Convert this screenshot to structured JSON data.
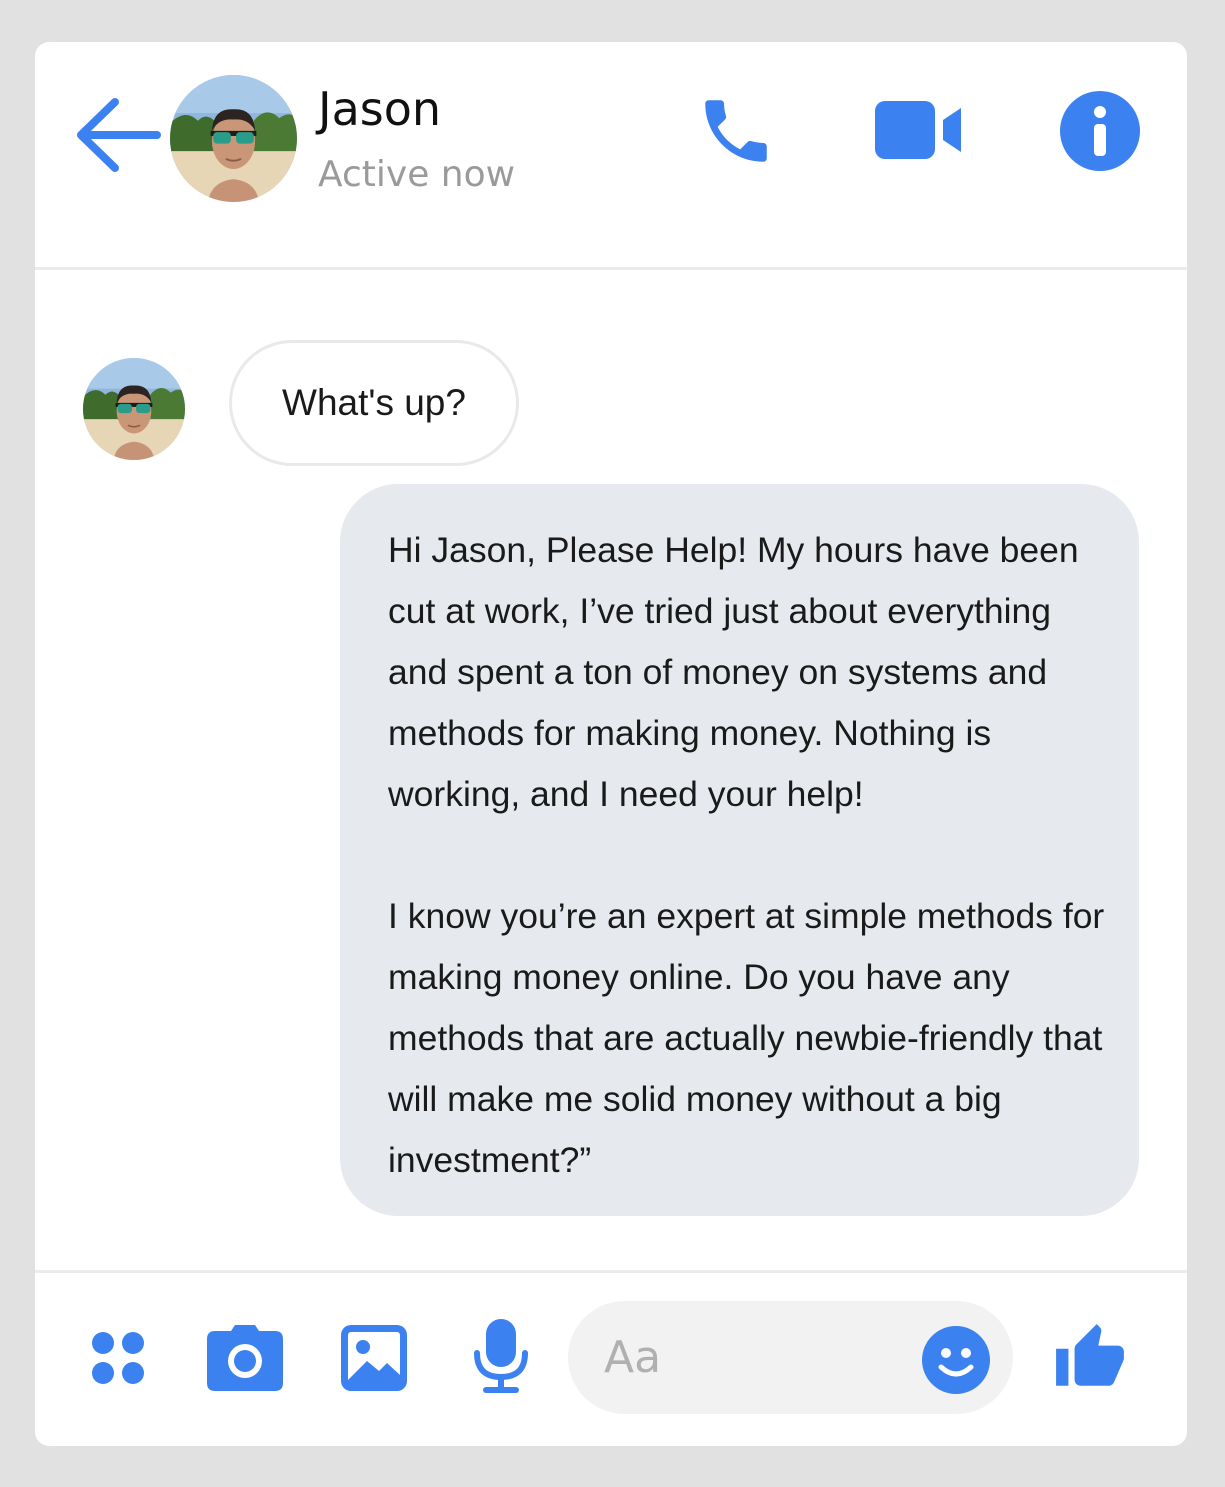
{
  "colors": {
    "accent": "#3b82f0",
    "outgoing_bubble": "#e6eaee",
    "incoming_bubble_border": "#e9e9e9",
    "status_text": "#9a9a9a"
  },
  "header": {
    "back_icon": "arrow-left-icon",
    "contact_name": "Jason",
    "contact_status": "Active now",
    "actions": [
      {
        "name": "call",
        "icon": "phone-icon"
      },
      {
        "name": "video",
        "icon": "video-camera-icon"
      },
      {
        "name": "info",
        "icon": "info-icon"
      }
    ]
  },
  "messages": [
    {
      "direction": "incoming",
      "sender": "Jason",
      "paragraphs": [
        "What's up?"
      ]
    },
    {
      "direction": "outgoing",
      "paragraphs": [
        "Hi Jason, Please Help! My hours have been cut at work, I’ve tried just about everything and spent a ton of money on systems and methods for making money. Nothing is working, and I need your help!",
        "I know you’re an expert at simple methods for making money online. Do you have any methods that are actually newbie-friendly that will make me solid money without a big investment?”"
      ]
    }
  ],
  "composer": {
    "placeholder": "Aa",
    "value": "",
    "icons": [
      "more-icon",
      "camera-icon",
      "gallery-icon",
      "microphone-icon",
      "emoji-icon",
      "thumbs-up-icon"
    ]
  }
}
